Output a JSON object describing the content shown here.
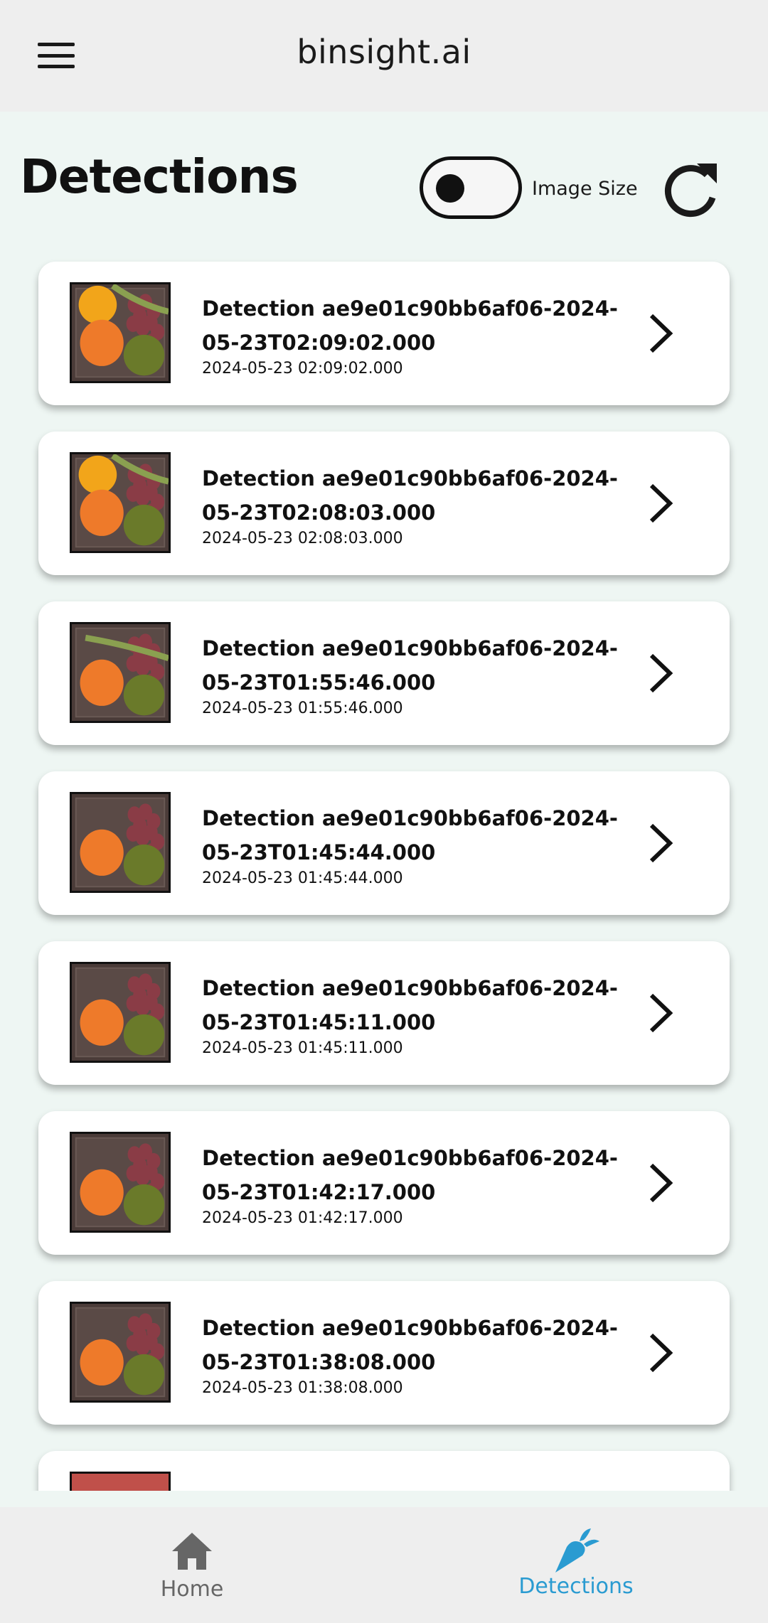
{
  "appbar": {
    "title": "binsight.ai",
    "menu_icon": "menu-icon"
  },
  "header": {
    "title": "Detections",
    "toggle_label": "Image Size",
    "refresh_icon": "refresh-icon"
  },
  "colors": {
    "accent": "#2a9bd1",
    "nav_inactive": "#666666",
    "background": "#eef6f3"
  },
  "detections": [
    {
      "title": "Detection ae9e01c90bb6af06-2024-05-23T02:09:02.000",
      "timestamp": "2024-05-23 02:09:02.000"
    },
    {
      "title": "Detection ae9e01c90bb6af06-2024-05-23T02:08:03.000",
      "timestamp": "2024-05-23 02:08:03.000"
    },
    {
      "title": "Detection ae9e01c90bb6af06-2024-05-23T01:55:46.000",
      "timestamp": "2024-05-23 01:55:46.000"
    },
    {
      "title": "Detection ae9e01c90bb6af06-2024-05-23T01:45:44.000",
      "timestamp": "2024-05-23 01:45:44.000"
    },
    {
      "title": "Detection ae9e01c90bb6af06-2024-05-23T01:45:11.000",
      "timestamp": "2024-05-23 01:45:11.000"
    },
    {
      "title": "Detection ae9e01c90bb6af06-2024-05-23T01:42:17.000",
      "timestamp": "2024-05-23 01:42:17.000"
    },
    {
      "title": "Detection ae9e01c90bb6af06-2024-05-23T01:38:08.000",
      "timestamp": "2024-05-23 01:38:08.000"
    }
  ],
  "bottom_nav": {
    "items": [
      {
        "label": "Home",
        "icon": "home-icon",
        "active": false
      },
      {
        "label": "Detections",
        "icon": "carrot-icon",
        "active": true
      }
    ]
  }
}
